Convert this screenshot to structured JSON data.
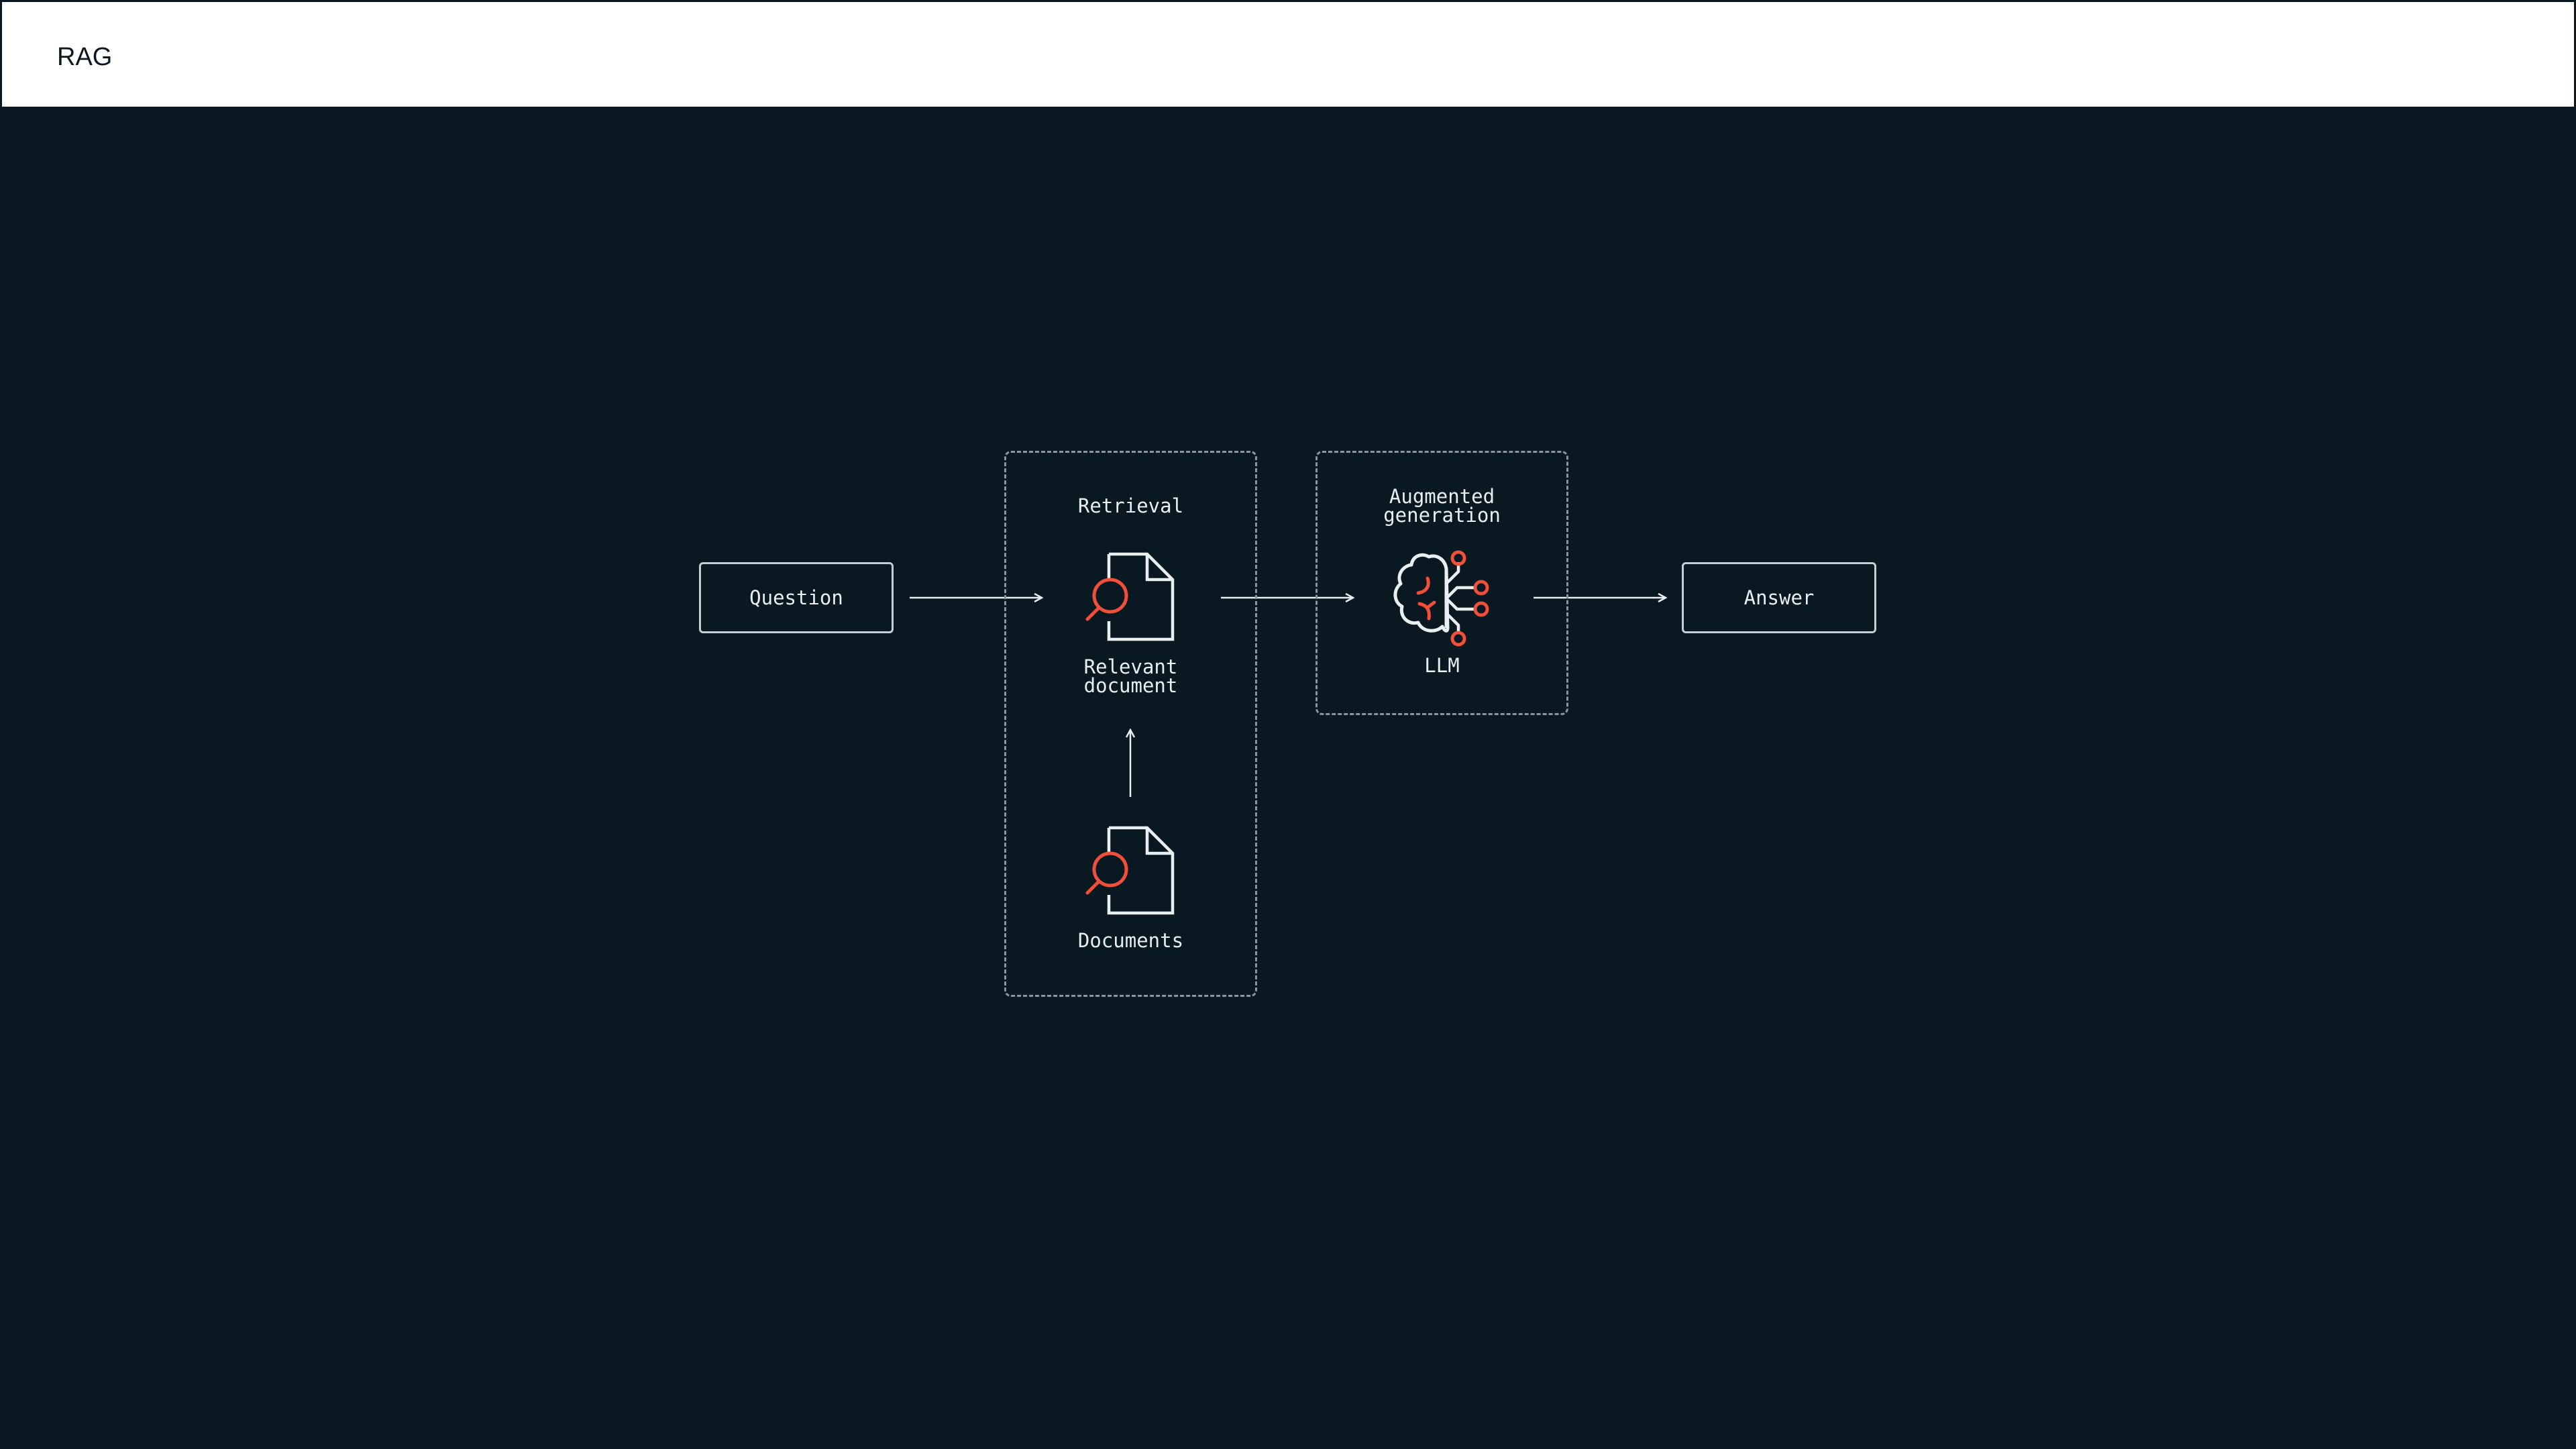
{
  "header": {
    "title": "RAG"
  },
  "diagram": {
    "nodes": {
      "question": "Question",
      "answer": "Answer"
    },
    "groups": {
      "retrieval": {
        "title": "Retrieval",
        "relevant_document": "Relevant\ndocument",
        "documents": "Documents"
      },
      "generation": {
        "title": "Augmented\ngeneration",
        "llm": "LLM"
      }
    },
    "icons": {
      "relevant_document": "document-search-icon",
      "documents": "document-search-icon",
      "llm": "brain-network-icon"
    },
    "colors": {
      "background": "#0a1921",
      "foreground": "#e9eef1",
      "accent": "#f04f3a",
      "dashed_border": "#8a959c"
    }
  }
}
